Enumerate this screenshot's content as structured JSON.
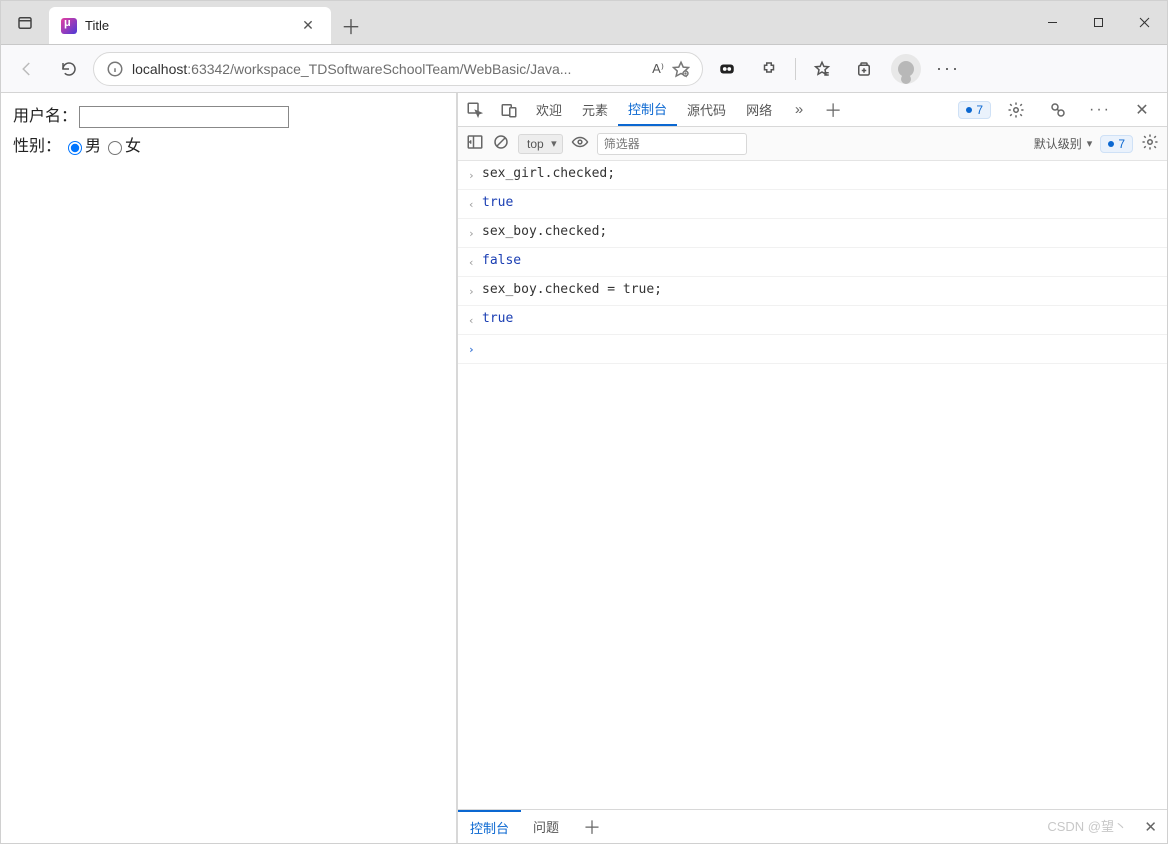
{
  "window": {
    "tab_title": "Title",
    "new_tab_icon": "plus-icon"
  },
  "toolbar": {
    "url_display_host": "localhost",
    "url_display_path": ":63342/workspace_TDSoftwareSchoolTeam/WebBasic/Java...",
    "read_aloud": "A⁾",
    "more": "···"
  },
  "page": {
    "username_label": "用户名：",
    "gender_label": "性别：",
    "gender_male": "男",
    "gender_female": "女",
    "gender_checked": "male"
  },
  "devtools": {
    "tabs": {
      "welcome": "欢迎",
      "elements": "元素",
      "console": "控制台",
      "sources": "源代码",
      "network": "网络"
    },
    "badge_count": "7",
    "sub": {
      "context": "top",
      "filter_placeholder": "筛选器",
      "level": "默认级别",
      "sub_badge": "7"
    },
    "console_lines": [
      {
        "type": "in",
        "text": "sex_girl.checked;"
      },
      {
        "type": "out",
        "text": "true",
        "cls": "kw-true"
      },
      {
        "type": "in",
        "text": "sex_boy.checked;"
      },
      {
        "type": "out",
        "text": "false",
        "cls": "kw-false"
      },
      {
        "type": "in",
        "text": "sex_boy.checked = true;"
      },
      {
        "type": "out",
        "text": "true",
        "cls": "kw-true"
      }
    ],
    "bottom_tabs": {
      "console": "控制台",
      "issues": "问题"
    }
  },
  "watermark": "CSDN @望丶"
}
